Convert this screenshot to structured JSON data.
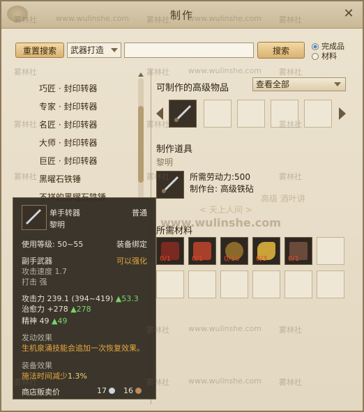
{
  "window": {
    "title": "制作",
    "close_glyph": "✕"
  },
  "toolbar": {
    "reset_label": "重置搜索",
    "category_value": "武器打造",
    "search_value": "",
    "search_label": "搜索"
  },
  "radios": [
    {
      "label": "完成品",
      "selected": true
    },
    {
      "label": "材料",
      "selected": false
    }
  ],
  "list": {
    "items": [
      "巧匠 · 封印转器",
      "专家 · 封印转器",
      "名匠 · 封印转器",
      "大师 · 封印转器",
      "巨匠 · 封印转器",
      "黑曜石铁锤",
      "不祥的黑曜石铁锤"
    ]
  },
  "right": {
    "section_advanced": "可制作的高级物品",
    "view_all": "查看全部",
    "section_tools": "制作道具",
    "tool_name": "黎明",
    "labor": "所需劳动力:500",
    "station": "制作台: 高级铁砧",
    "section_materials": "所需材料",
    "materials": [
      {
        "qty": "0/1",
        "color": "#7a2a20"
      },
      {
        "qty": "0/1",
        "color": "#a8402a"
      },
      {
        "qty": "0/10",
        "color": "#8a6a2a"
      },
      {
        "qty": "0/3",
        "color": "#c9a23a"
      },
      {
        "qty": "0/1",
        "color": "#6a4a3a"
      }
    ]
  },
  "tooltip": {
    "name": "单手转器",
    "grade": "普通",
    "subname": "黎明",
    "level_req": "使用等级: 50~55",
    "bind": "装备绑定",
    "slot": "副手武器",
    "enhance": "可以强化",
    "speed": "攻击速度 1.7",
    "hit": "打击 强",
    "attack_label": "攻击力 239.1 (394~419)",
    "attack_delta": "▲53.3",
    "heal_label": "治愈力 +278",
    "heal_delta": "▲278",
    "spirit_label": "精神  49",
    "spirit_delta": "▲49",
    "proc_title": "发动效果",
    "proc_text": "生机泉涌技能会追加一次恢复效果。",
    "equip_title": "装备效果",
    "equip_text_a": "施法时间减少",
    "equip_text_b": "1.3%",
    "sell_label": "商店贩卖价",
    "silver": "17",
    "copper": "16"
  },
  "watermarks": {
    "site": "www.wulinshe.com",
    "brand": "雾林社"
  },
  "overlay_text": {
    "a": "高级 酒叶讲",
    "b": "< 天上人间 >"
  },
  "colors": {
    "accent_green": "#7ad36a",
    "accent_orange": "#e5a83b",
    "accent_yellow": "#f1d66a"
  }
}
